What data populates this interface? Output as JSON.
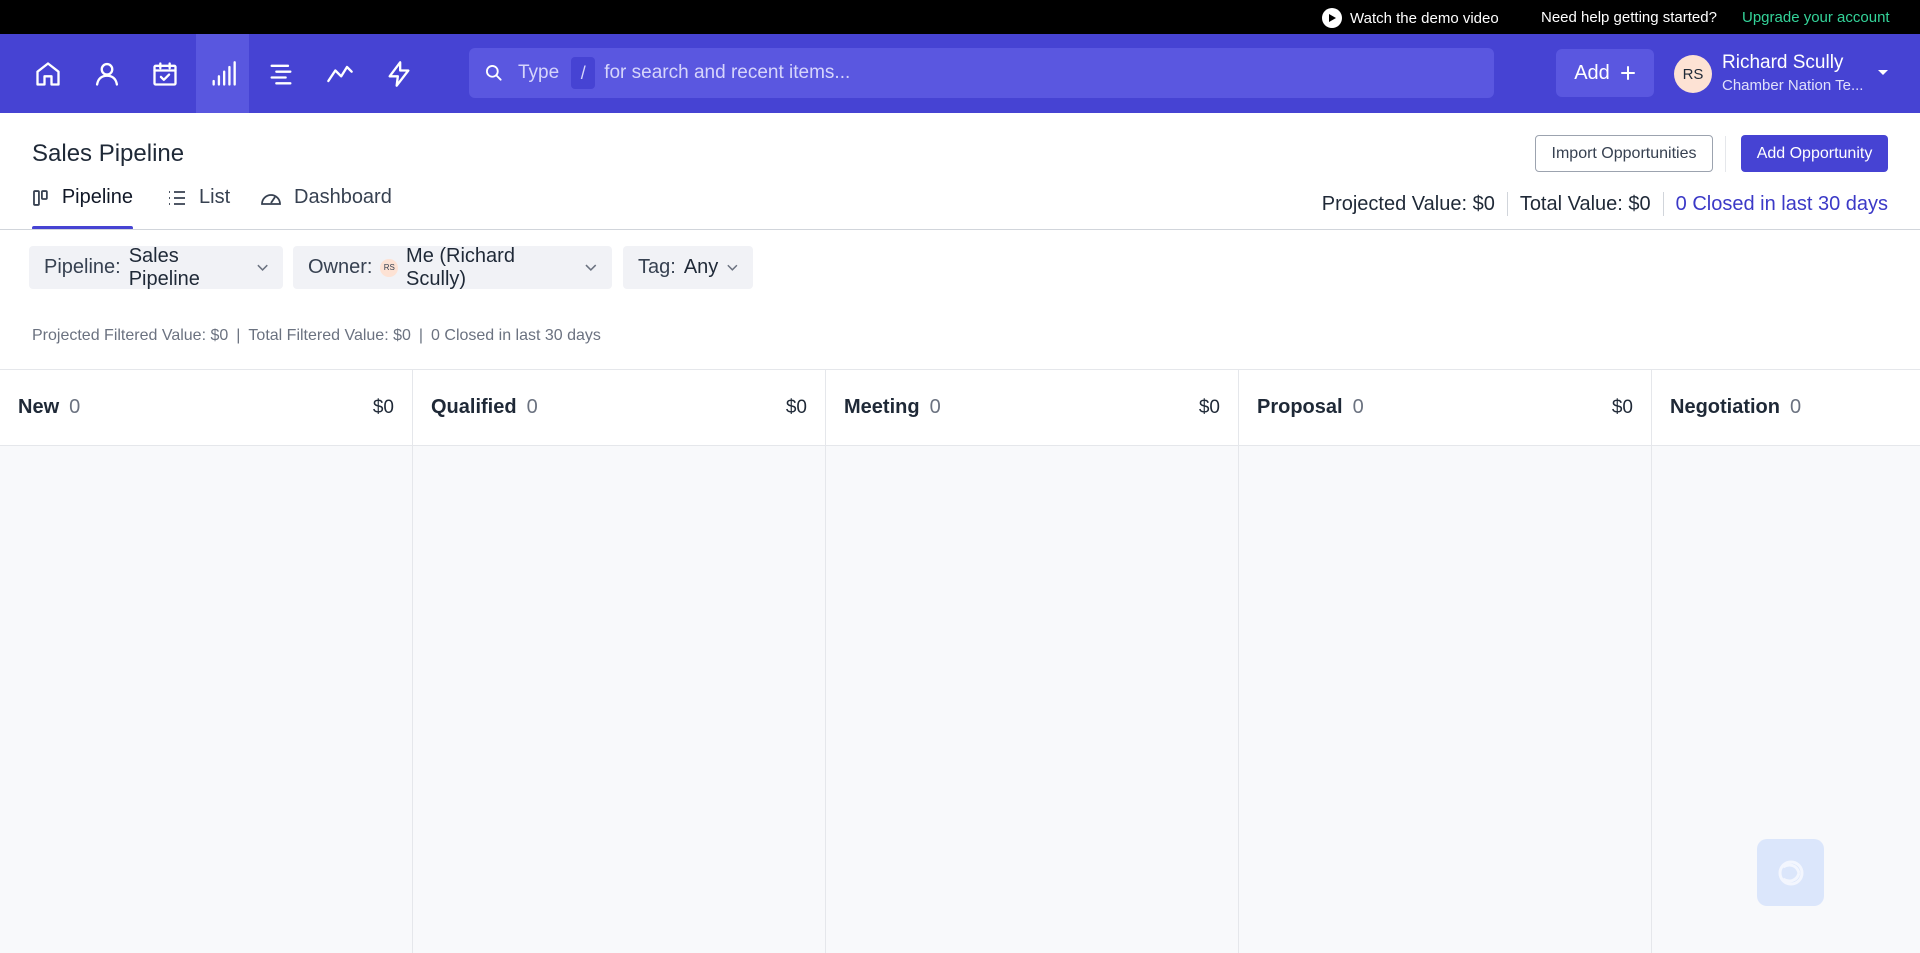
{
  "topbar": {
    "demo_label": "Watch the demo video",
    "help_label": "Need help getting started?",
    "upgrade_label": "Upgrade your account"
  },
  "nav": {
    "icons": [
      "home-icon",
      "person-icon",
      "calendar-check-icon",
      "bar-chart-icon",
      "align-icon",
      "trend-line-icon",
      "lightning-icon"
    ],
    "active_index": 3,
    "search": {
      "prefix": "Type",
      "shortcut": "/",
      "placeholder": "for search and recent items..."
    },
    "add_label": "Add",
    "user": {
      "initials": "RS",
      "name": "Richard Scully",
      "org": "Chamber Nation Te..."
    }
  },
  "colors": {
    "brand": "#4643d3",
    "upgrade": "#34d399",
    "closed_link": "#3b39c7"
  },
  "page": {
    "title": "Sales Pipeline",
    "import_label": "Import Opportunities",
    "add_opportunity_label": "Add Opportunity",
    "tabs": [
      {
        "label": "Pipeline",
        "icon": "kanban-icon",
        "active": true
      },
      {
        "label": "List",
        "icon": "list-icon",
        "active": false
      },
      {
        "label": "Dashboard",
        "icon": "gauge-icon",
        "active": false
      }
    ],
    "totals": {
      "projected": "Projected Value: $0",
      "total": "Total Value: $0",
      "closed": "0 Closed in last 30 days"
    }
  },
  "filters": {
    "pipeline": {
      "label": "Pipeline:",
      "value": "Sales Pipeline"
    },
    "owner": {
      "label": "Owner:",
      "avatar": "RS",
      "value": "Me (Richard Scully)"
    },
    "tag": {
      "label": "Tag:",
      "value": "Any"
    }
  },
  "filtered_totals": {
    "projected": "Projected Filtered Value: $0",
    "sep": "|",
    "total": "Total Filtered Value: $0",
    "closed": "0 Closed in last 30 days"
  },
  "stages": [
    {
      "name": "New",
      "count": "0",
      "value": "$0"
    },
    {
      "name": "Qualified",
      "count": "0",
      "value": "$0"
    },
    {
      "name": "Meeting",
      "count": "0",
      "value": "$0"
    },
    {
      "name": "Proposal",
      "count": "0",
      "value": "$0"
    },
    {
      "name": "Negotiation",
      "count": "0",
      "value": ""
    }
  ]
}
